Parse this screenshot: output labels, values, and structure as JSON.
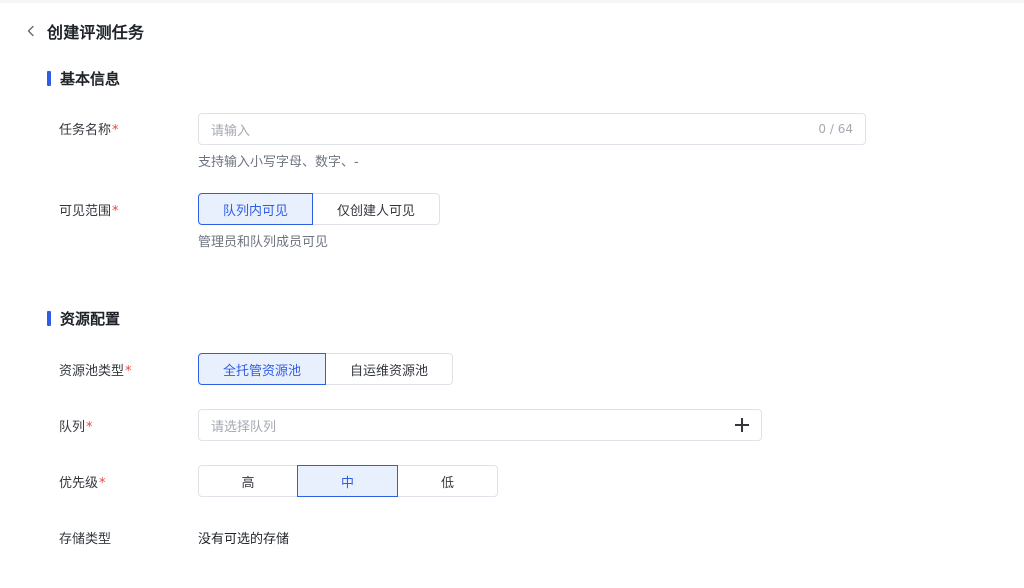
{
  "header": {
    "title": "创建评测任务"
  },
  "basic_info": {
    "title": "基本信息",
    "task_name": {
      "label": "任务名称",
      "required_mark": "*",
      "placeholder": "请输入",
      "counter": "0 / 64",
      "hint": "支持输入小写字母、数字、-"
    },
    "visibility": {
      "label": "可见范围",
      "required_mark": "*",
      "options": [
        "队列内可见",
        "仅创建人可见"
      ],
      "selected": "队列内可见",
      "hint": "管理员和队列成员可见"
    }
  },
  "resource_config": {
    "title": "资源配置",
    "pool_type": {
      "label": "资源池类型",
      "required_mark": "*",
      "options": [
        "全托管资源池",
        "自运维资源池"
      ],
      "selected": "全托管资源池"
    },
    "queue": {
      "label": "队列",
      "required_mark": "*",
      "placeholder": "请选择队列"
    },
    "priority": {
      "label": "优先级",
      "required_mark": "*",
      "options": [
        "高",
        "中",
        "低"
      ],
      "selected": "中"
    },
    "storage_type": {
      "label": "存储类型",
      "value": "没有可选的存储"
    }
  },
  "colors": {
    "accent": "#2f5ee6",
    "accent_bg": "#e8effd",
    "required": "#f0443c",
    "border": "#dfe2e8"
  }
}
